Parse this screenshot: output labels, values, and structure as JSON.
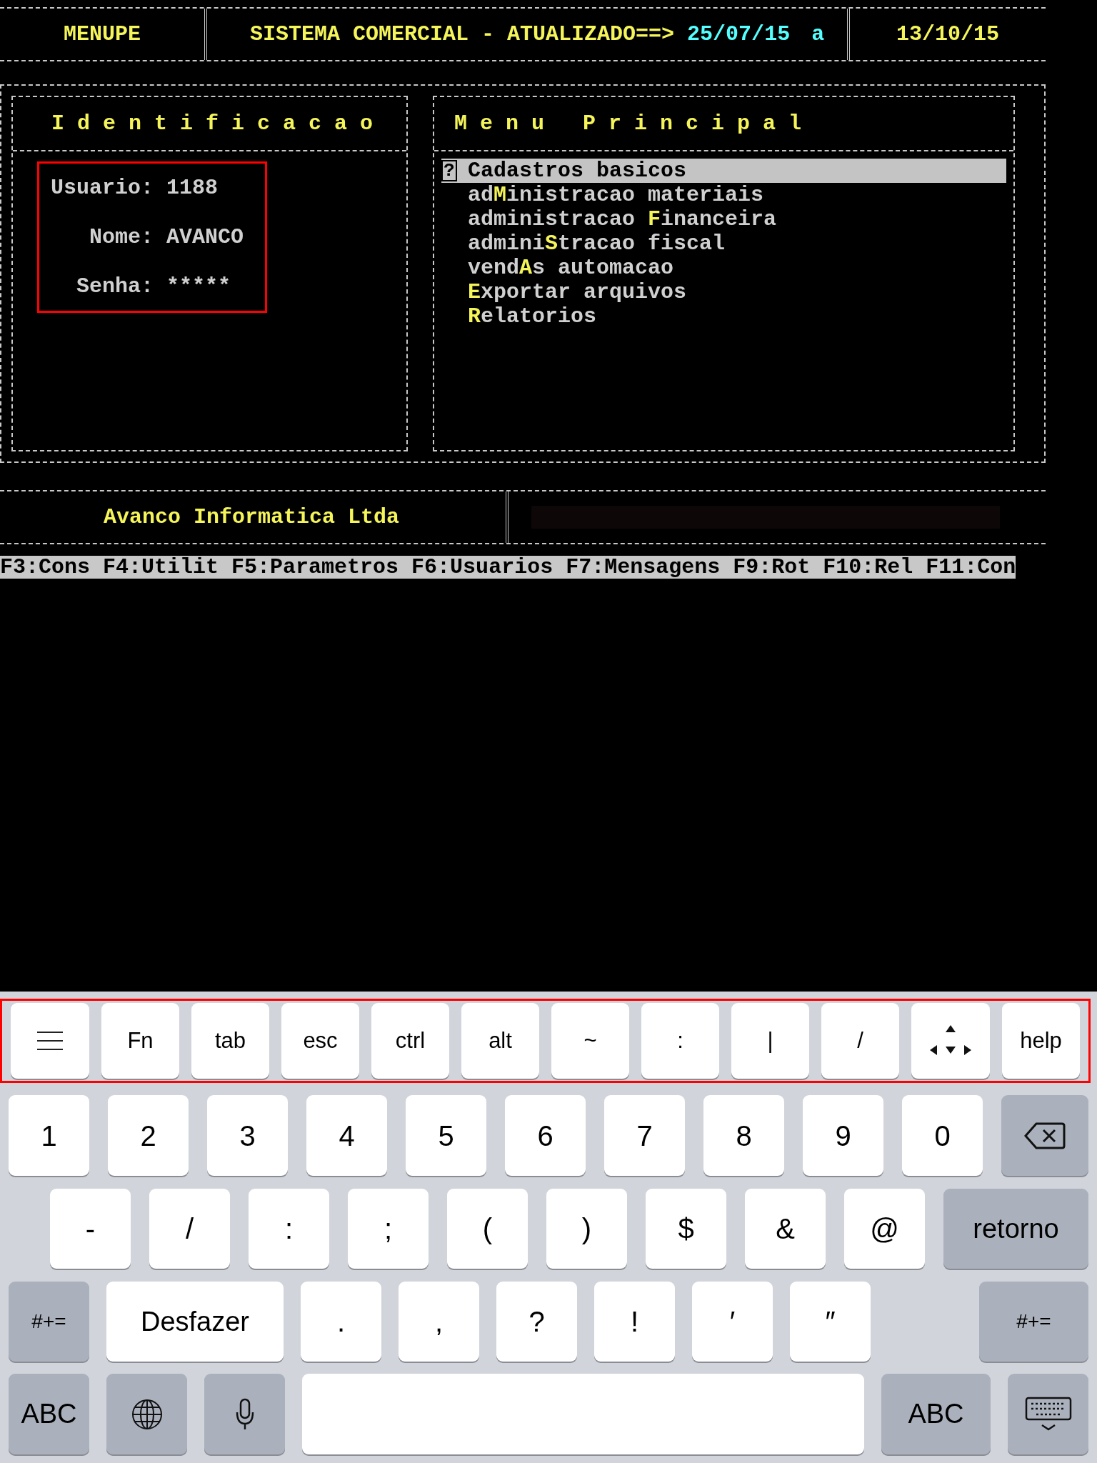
{
  "terminal": {
    "header": {
      "program": "MENUPE",
      "title": "SISTEMA COMERCIAL - ATUALIZADO==>",
      "updated": "25/07/15",
      "suffix": "a",
      "date": "13/10/15"
    },
    "identification": {
      "title": "I d e n t i f i c a c a o",
      "fields": [
        {
          "label": "Usuario:",
          "value": "1188"
        },
        {
          "label": "Nome:",
          "value": "AVANCO"
        },
        {
          "label": "Senha:",
          "value": "*****"
        }
      ]
    },
    "menu": {
      "title": "M e n u   P r i n c i p a l",
      "cursor": "?",
      "items": [
        {
          "hotkey": "C",
          "after": "adastros basicos",
          "selected": true
        },
        {
          "before": "ad",
          "hotkey": "M",
          "after": "inistracao materiais",
          "selected": false
        },
        {
          "before": "administracao ",
          "hotkey": "F",
          "after": "inanceira",
          "selected": false
        },
        {
          "before": "admini",
          "hotkey": "S",
          "after": "tracao fiscal",
          "selected": false
        },
        {
          "before": "vend",
          "hotkey": "A",
          "after": "s automacao",
          "selected": false
        },
        {
          "hotkey": "E",
          "after": "xportar arquivos",
          "selected": false
        },
        {
          "hotkey": "R",
          "after": "elatorios",
          "selected": false
        }
      ]
    },
    "company": "Avanco Informatica Ltda",
    "function_keys": [
      "F3:Cons",
      "F4:Utilit",
      "F5:Parametros",
      "F6:Usuarios",
      "F7:Mensagens",
      "F9:Rot",
      "F10:Rel",
      "F11:Con"
    ]
  },
  "keyboard": {
    "toolbar": [
      "Fn",
      "tab",
      "esc",
      "ctrl",
      "alt",
      "~",
      ":",
      "|",
      "/"
    ],
    "toolbar_last": "help",
    "row_1": [
      "1",
      "2",
      "3",
      "4",
      "5",
      "6",
      "7",
      "8",
      "9",
      "0"
    ],
    "row_2": [
      "-",
      "/",
      ":",
      ";",
      "(",
      ")",
      "$",
      "&",
      "@"
    ],
    "return": "retorno",
    "row_3_left": "#+=",
    "undo": "Desfazer",
    "row_3": [
      ".",
      ",",
      "?",
      "!",
      "′",
      "″"
    ],
    "row_3_right": "#+=",
    "row_4_left": "ABC",
    "row_4_right": "ABC"
  }
}
